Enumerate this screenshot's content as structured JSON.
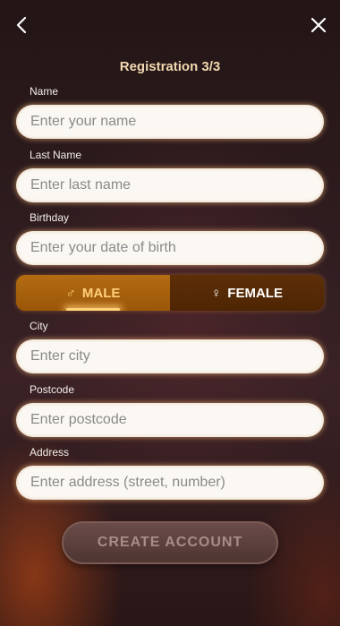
{
  "header": {
    "title": "Registration 3/3",
    "back_icon": "chevron-left-icon",
    "close_icon": "close-icon"
  },
  "form": {
    "name": {
      "label": "Name",
      "placeholder": "Enter your name"
    },
    "last_name": {
      "label": "Last Name",
      "placeholder": "Enter last name"
    },
    "birthday": {
      "label": "Birthday",
      "placeholder": "Enter your date of birth"
    },
    "gender": {
      "male": {
        "label": "MALE",
        "icon": "♂",
        "selected": true
      },
      "female": {
        "label": "FEMALE",
        "icon": "♀",
        "selected": false
      }
    },
    "city": {
      "label": "City",
      "placeholder": "Enter city"
    },
    "postcode": {
      "label": "Postcode",
      "placeholder": "Enter postcode"
    },
    "address": {
      "label": "Address",
      "placeholder": "Enter address (street, number)"
    }
  },
  "actions": {
    "create_account_label": "CREATE ACCOUNT"
  },
  "colors": {
    "title": "#f2d9b0",
    "male_selected_text": "#ffcf7a",
    "field_bg": "#fbf8f3",
    "cta_bg": "#5a3f3c"
  }
}
